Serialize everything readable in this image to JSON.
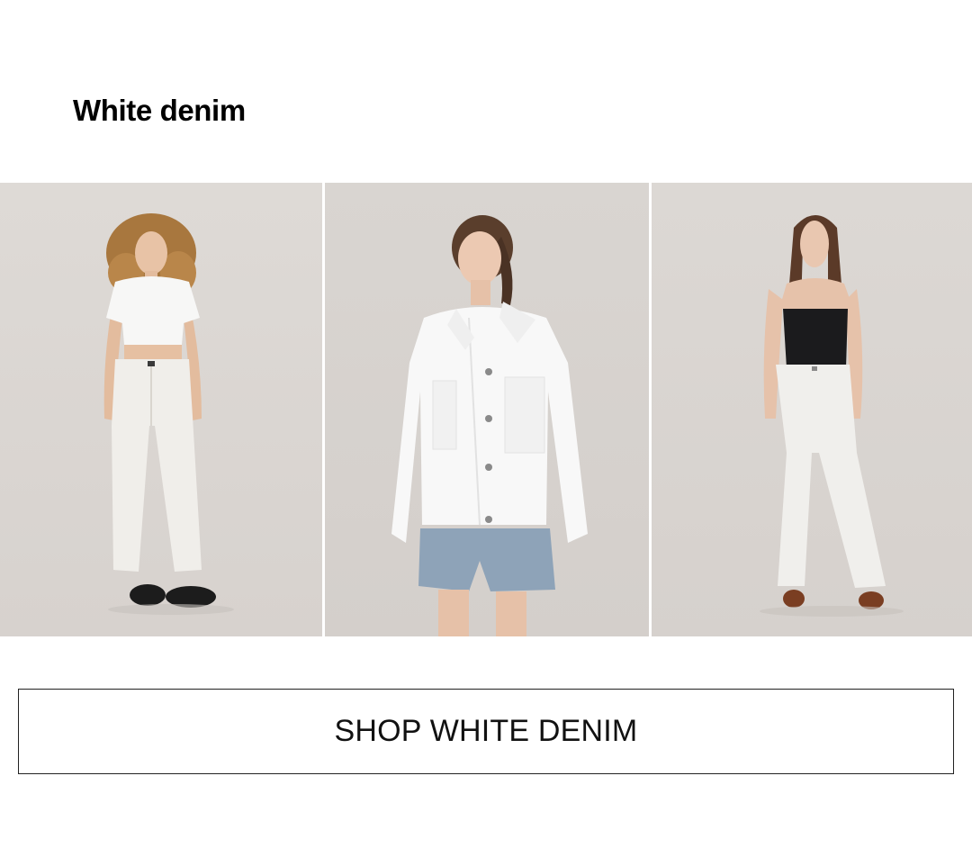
{
  "section": {
    "title": "White denim"
  },
  "gallery": {
    "items": [
      {
        "name": "look-cropped-tee-white-jeans"
      },
      {
        "name": "look-white-denim-jacket"
      },
      {
        "name": "look-black-tube-top-white-jeans"
      }
    ]
  },
  "cta": {
    "label": "SHOP WHITE DENIM"
  },
  "colors": {
    "background": "#ffffff",
    "tile_background": "#d9d5d1",
    "text": "#000000",
    "button_border": "#222222"
  }
}
